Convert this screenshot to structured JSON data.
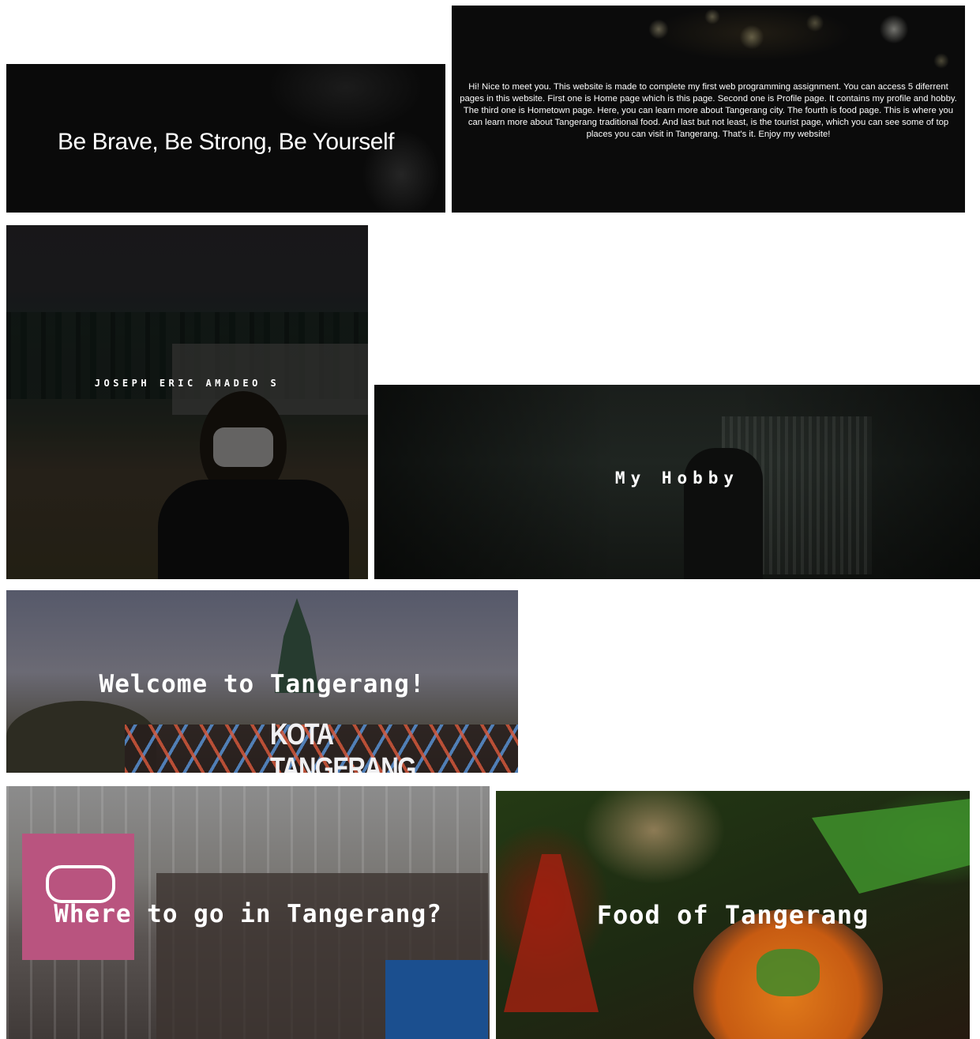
{
  "tiles": {
    "motto": {
      "caption": "Be Brave, Be Strong, Be Yourself"
    },
    "intro": {
      "caption": "Hi! Nice to meet you. This website is made to complete my first web programming assignment. You can access 5 diferrent pages in this website. First one is Home page which is this page. Second one is Profile page. It contains my profile and hobby. The third one is Hometown page. Here, you can learn more about Tangerang city. The fourth is food page. This is where you can learn more about Tangerang traditional food. And last but not least, is the tourist page, which you can see some of top places you can visit in Tangerang. That's it. Enjoy my website!"
    },
    "profile": {
      "caption": "JOSEPH ERIC AMADEO S"
    },
    "hobby": {
      "caption": "My Hobby"
    },
    "hometown": {
      "caption": "Welcome to Tangerang!",
      "sign_text": "KOTA TANGERANG"
    },
    "tourist": {
      "caption": "Where to go in Tangerang?"
    },
    "food": {
      "caption": "Food of Tangerang"
    }
  }
}
